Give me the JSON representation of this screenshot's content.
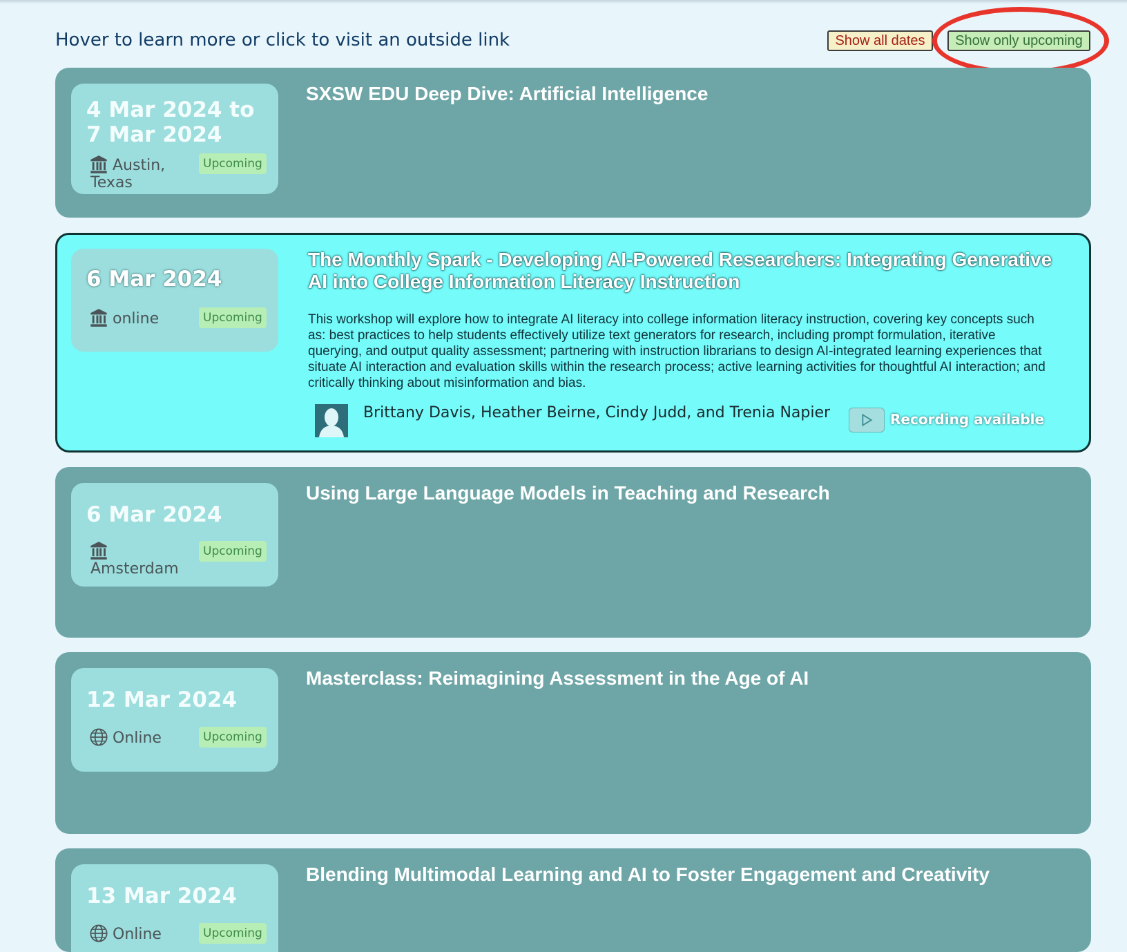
{
  "header": {
    "instruction": "Hover to learn more or click to visit an outside link",
    "buttons": {
      "show_all": "Show all dates",
      "show_upcoming": "Show only upcoming"
    }
  },
  "events": [
    {
      "date": "4 Mar 2024 to 7 Mar 2024",
      "location": "Austin, Texas",
      "location_icon": "building-icon",
      "badge": "Upcoming",
      "title": "SXSW EDU Deep Dive: Artificial Intelligence"
    },
    {
      "date": "6 Mar 2024",
      "location": "online",
      "location_icon": "building-icon",
      "badge": "Upcoming",
      "title": "The Monthly Spark - Developing AI-Powered Researchers: Integrating Generative AI into College Information Literacy Instruction",
      "description": "This workshop will explore how to integrate AI literacy into college information literacy instruction, covering key concepts such as:  best practices to help students effectively utilize text generators for research, including prompt formulation, iterative querying, and output quality assessment;  partnering with instruction librarians to design AI-integrated learning experiences that situate AI interaction and evaluation skills within the research process; active learning activities for thoughtful AI interaction; and critically thinking about misinformation and bias.",
      "presenters": "Brittany Davis, Heather Beirne, Cindy Judd, and Trenia Napier",
      "recording": "Recording available"
    },
    {
      "date": "6 Mar 2024",
      "location": "Amsterdam",
      "location_icon": "building-icon",
      "badge": "Upcoming",
      "title": "Using Large Language Models in Teaching and Research"
    },
    {
      "date": "12 Mar 2024",
      "location": "Online",
      "location_icon": "globe-icon",
      "badge": "Upcoming",
      "title": "Masterclass: Reimagining Assessment in the Age of AI"
    },
    {
      "date": "13 Mar 2024",
      "location": "Online",
      "location_icon": "globe-icon",
      "badge": "Upcoming",
      "title": "Blending Multimodal Learning and AI to Foster Engagement and Creativity"
    }
  ],
  "colors": {
    "page_background": "#e8f6fc",
    "card": "#6ea6a7",
    "card_highlight": "#74fbfa",
    "date_box": "#9cdddd",
    "badge": "#b7eeb6",
    "annotation": "#e8352b"
  }
}
